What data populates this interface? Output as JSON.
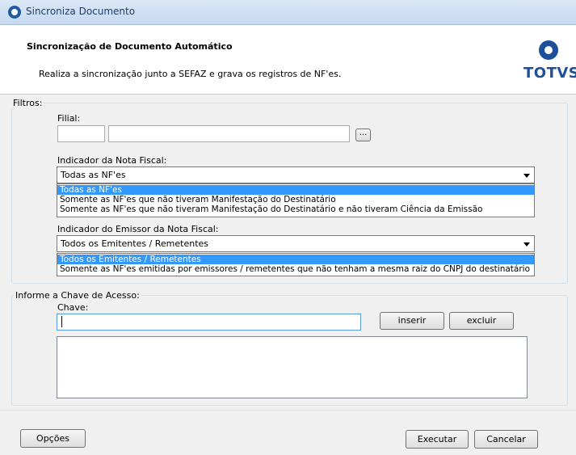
{
  "window": {
    "title": "Sincroniza Documento"
  },
  "header": {
    "title": "Sincronização de Documento Automático",
    "description": "Realiza a sincronização junto a SEFAZ e grava os registros de NF'es.",
    "logo_text": "TOTVS"
  },
  "filters": {
    "legend": "Filtros:",
    "filial": {
      "label": "Filial:",
      "code_value": "",
      "name_value": "",
      "lookup_label": "..."
    },
    "indicador_nf": {
      "label": "Indicador da Nota Fiscal:",
      "selected": "Todas as NF'es",
      "options": [
        "Todas as NF'es",
        "Somente as NF'es que não tiveram Manifestação do Destinatário",
        "Somente as NF'es que não tiveram Manifestação do Destinatário e não tiveram Ciência da Emissão"
      ]
    },
    "indicador_emissor": {
      "label": "Indicador do Emissor da Nota Fiscal:",
      "selected": "Todos os Emitentes / Remetentes",
      "options": [
        "Todos os Emitentes / Remetentes",
        "Somente as NF'es emitidas por emissores / remetentes que não tenham a mesma raiz do CNPJ do destinatário"
      ]
    }
  },
  "chave": {
    "legend": "Informe a Chave de Acesso:",
    "label": "Chave:",
    "value": "",
    "insert_label": "inserir",
    "delete_label": "excluir"
  },
  "footer": {
    "options_label": "Opções",
    "execute_label": "Executar",
    "cancel_label": "Cancelar"
  }
}
